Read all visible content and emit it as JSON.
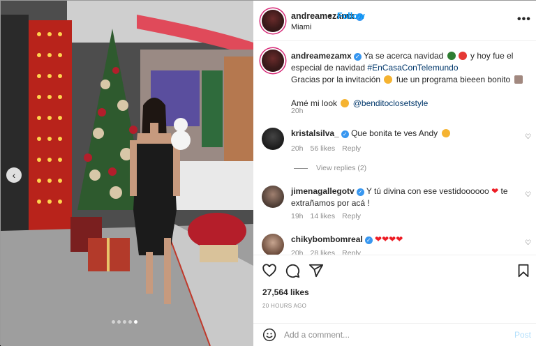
{
  "post": {
    "username": "andreamezamx",
    "follow_label": "Follow",
    "bullet": "•",
    "location": "Miami",
    "more_label": "•••",
    "caption_lines": [
      "Ya se acerca navidad",
      "y hoy fue el",
      "especial de navidad",
      "#EnCasaConTelemundo",
      "Gracias por la invitación",
      "fue un programa bieeen bonito",
      "Amé mi look",
      "@benditoclosetstyle"
    ],
    "caption_time": "20h",
    "likes": "27,564 likes",
    "time_ago": "20 HOURS AGO",
    "carousel": {
      "total_dots": 5,
      "active_index": 4
    }
  },
  "comments": [
    {
      "username": "kristalsilva_",
      "text": "Que bonita te ves Andy",
      "time": "20h",
      "likes": "56 likes",
      "reply": "Reply",
      "view_replies": "View replies (2)"
    },
    {
      "username": "jimenagallegotv",
      "text_a": "Y tú divina con ese vestidoooooo",
      "text_b": "te",
      "text_c": "extrañamos por acá !",
      "time": "19h",
      "likes": "14 likes",
      "reply": "Reply"
    },
    {
      "username": "chikybombomreal",
      "text": "",
      "time": "20h",
      "likes": "28 likes",
      "reply": "Reply"
    }
  ],
  "composer": {
    "placeholder": "Add a comment...",
    "post_label": "Post"
  },
  "icons": {
    "like": "heart-icon",
    "comment": "comment-icon",
    "share": "paper-plane-icon",
    "save": "bookmark-icon",
    "emoji": "smiley-icon",
    "more": "more-horizontal-icon",
    "prev": "chevron-left-icon",
    "verified": "verified-badge-icon"
  },
  "colors": {
    "accent": "#0095f6",
    "hashtag": "#00376b",
    "muted": "#8e8e8e",
    "heart": "#ed1c24"
  }
}
